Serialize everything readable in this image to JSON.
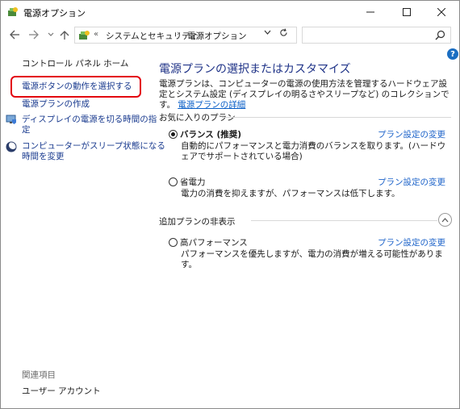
{
  "window": {
    "title": "電源オプション",
    "icon": "power-options-icon"
  },
  "nav": {
    "breadcrumb_prefix": "«",
    "breadcrumb_1": "システムとセキュリティ",
    "breadcrumb_separator": "›",
    "breadcrumb_2": "電源オプション",
    "search_placeholder": ""
  },
  "sidebar": {
    "home": "コントロール パネル ホーム",
    "items": [
      {
        "label": "電源ボタンの動作を選択する",
        "highlighted": true
      },
      {
        "label": "電源プランの作成"
      },
      {
        "label": "ディスプレイの電源を切る時間の指\n定",
        "icon": "display-shield-icon"
      },
      {
        "label": "コンピューターがスリープ状態になる\n時間を変更",
        "icon": "moon-shield-icon"
      }
    ],
    "related_heading": "関連項目",
    "user_accounts": "ユーザー アカウント"
  },
  "main": {
    "title": "電源プランの選択またはカスタマイズ",
    "description": "電源プランは、コンピューターの電源の使用方法を管理するハードウェア設定とシステム設定 (ディスプレイの明るさやスリープなど) のコレクションです。",
    "description_link": "電源プランの詳細",
    "favorites_heading": "お気に入りのプラン",
    "additional_heading": "追加プランの非表示",
    "plans": [
      {
        "name": "バランス (推奨)",
        "checked": true,
        "link": "プラン設定の変更",
        "description": "自動的にパフォーマンスと電力消費のバランスを取ります。(ハードウェアでサポートされている場合)"
      },
      {
        "name": "省電力",
        "checked": false,
        "link": "プラン設定の変更",
        "description": "電力の消費を抑えますが、パフォーマンスは低下します。"
      },
      {
        "name": "高パフォーマンス",
        "checked": false,
        "link": "プラン設定の変更",
        "description": "パフォーマンスを優先しますが、電力の消費が増える可能性があります。"
      }
    ]
  },
  "colors": {
    "title_blue": "#1e3287",
    "link_blue": "#1d63c9",
    "highlight_red": "#e3000f"
  }
}
